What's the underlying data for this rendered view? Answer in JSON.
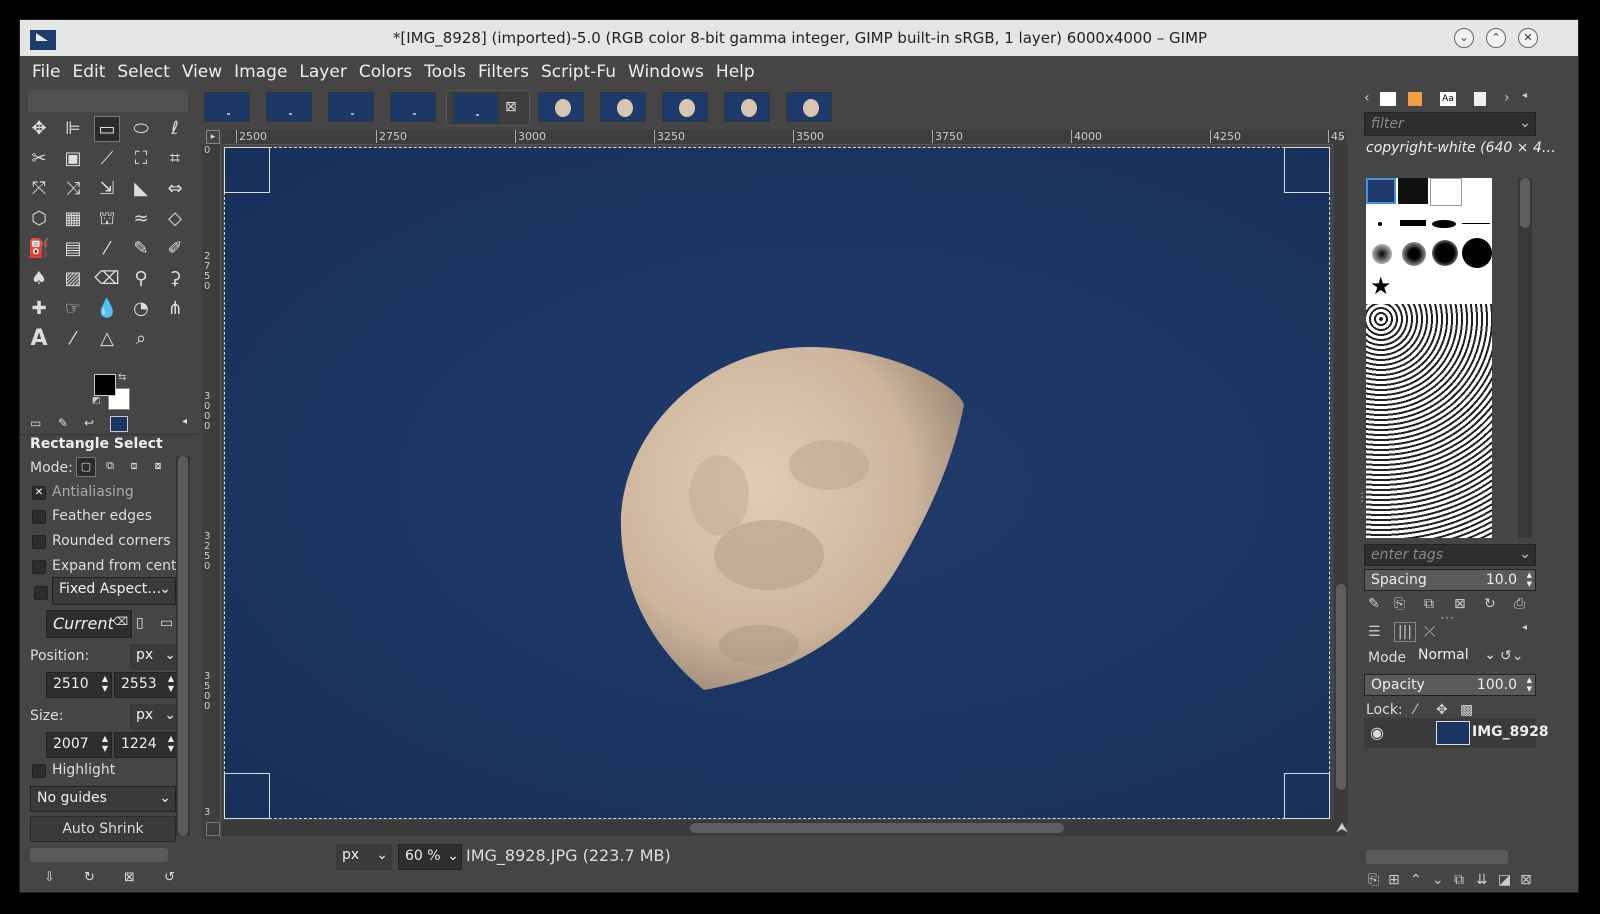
{
  "window": {
    "title": "*[IMG_8928] (imported)-5.0 (RGB color 8-bit gamma integer, GIMP built-in sRGB, 1 layer) 6000x4000 – GIMP",
    "minimize": "⌄",
    "maximize": "⌃",
    "close": "✕"
  },
  "menu": [
    "File",
    "Edit",
    "Select",
    "View",
    "Image",
    "Layer",
    "Colors",
    "Tools",
    "Filters",
    "Script-Fu",
    "Windows",
    "Help"
  ],
  "tool_options": {
    "title": "Rectangle Select",
    "mode_label": "Mode:",
    "antialiasing": "Antialiasing",
    "feather_edges": "Feather edges",
    "rounded_corners": "Rounded corners",
    "expand_from_center": "Expand from cente",
    "fixed_aspect": "Fixed Aspect…",
    "current": "Current",
    "position_label": "Position:",
    "position_unit": "px",
    "position_x": "2510",
    "position_y": "2553",
    "size_label": "Size:",
    "size_unit": "px",
    "size_w": "2007",
    "size_h": "1224",
    "highlight": "Highlight",
    "guides": "No guides",
    "auto_shrink": "Auto Shrink"
  },
  "ruler": {
    "h": [
      "2500",
      "2750",
      "3000",
      "3250",
      "3500",
      "3750",
      "4000",
      "4250",
      "45"
    ],
    "v": [
      "0",
      "2750",
      "3000",
      "3250",
      "3500",
      "3"
    ]
  },
  "status": {
    "unit": "px",
    "zoom": "60 %",
    "file": "IMG_8928.JPG (223.7 MB)"
  },
  "brushes": {
    "filter_placeholder": "filter",
    "selected_name": "copyright-white (640 × 4…",
    "tags_placeholder": "enter tags",
    "spacing_label": "Spacing",
    "spacing_value": "10.0"
  },
  "layers": {
    "mode_label": "Mode",
    "mode_value": "Normal",
    "opacity_label": "Opacity",
    "opacity_value": "100.0",
    "lock_label": "Lock:",
    "layer_name": "IMG_8928"
  },
  "colors": {
    "sky": "#1b3562",
    "moon": "#d9c4ad"
  }
}
